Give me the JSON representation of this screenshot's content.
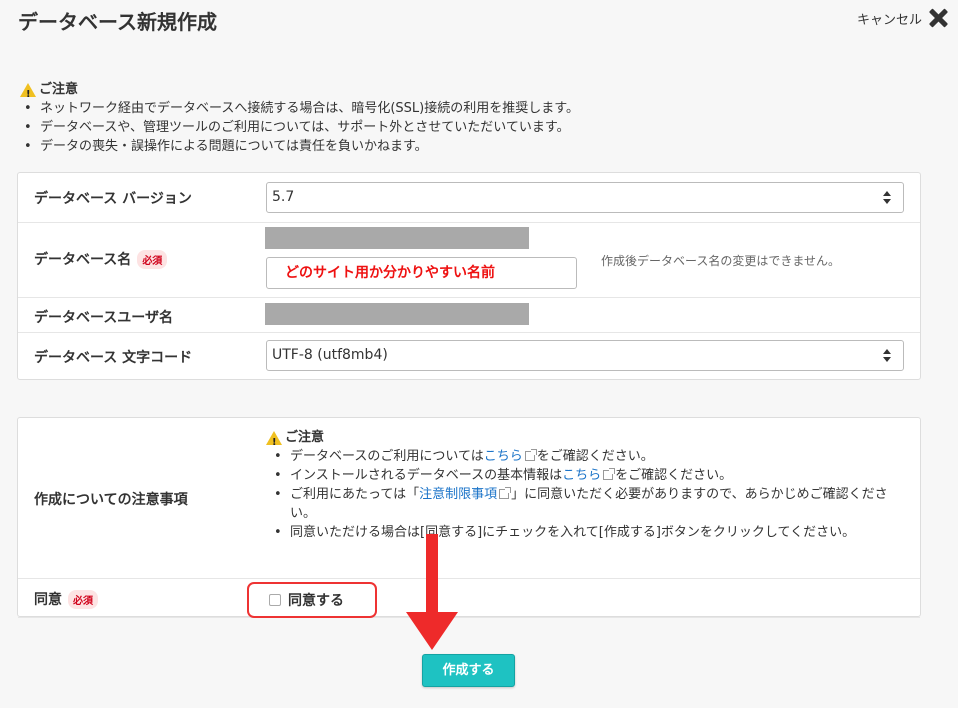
{
  "header": {
    "title": "データベース新規作成",
    "cancel_label": "キャンセル"
  },
  "notice": {
    "heading": "ご注意",
    "items": [
      "ネットワーク経由でデータベースへ接続する場合は、暗号化(SSL)接続の利用を推奨します。",
      "データベースや、管理ツールのご利用については、サポート外とさせていただいています。",
      "データの喪失・誤操作による問題については責任を負いかねます。"
    ]
  },
  "form": {
    "version": {
      "label": "データベース バージョン",
      "value": "5.7"
    },
    "db_name": {
      "label": "データベース名",
      "required": "必須",
      "value": "どのサイト用か分かりやすい名前",
      "hint": "作成後データベース名の変更はできません。"
    },
    "db_user": {
      "label": "データベースユーザ名"
    },
    "charset": {
      "label": "データベース 文字コード",
      "value": "UTF-8 (utf8mb4)"
    }
  },
  "terms": {
    "label": "作成についての注意事項",
    "heading": "ご注意",
    "item1_pre": "データベースのご利用については",
    "item1_link": "こちら",
    "item1_post": "をご確認ください。",
    "item2_pre": "インストールされるデータベースの基本情報は",
    "item2_link": "こちら",
    "item2_post": "をご確認ください。",
    "item3_pre": "ご利用にあたっては「",
    "item3_link": "注意制限事項",
    "item3_post": "」に同意いただく必要がありますので、あらかじめご確認ください。",
    "item4": "同意いただける場合は[同意する]にチェックを入れて[作成する]ボタンをクリックしてください。"
  },
  "agree": {
    "label": "同意",
    "required": "必須",
    "checkbox_label": "同意する",
    "checked": false
  },
  "actions": {
    "create_label": "作成する"
  },
  "colors": {
    "accent": "#1ec2c2",
    "highlight": "#e33333",
    "required": "#d0021b",
    "link": "#1a73c8"
  }
}
